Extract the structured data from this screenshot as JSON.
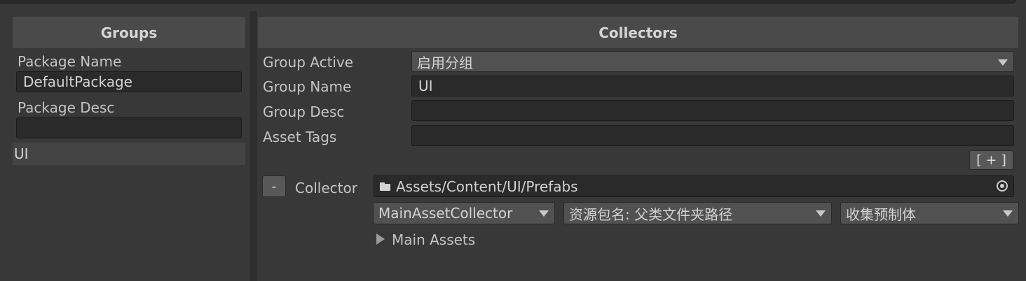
{
  "groups_panel": {
    "header": "Groups",
    "package_name_label": "Package Name",
    "package_name_value": "DefaultPackage",
    "package_desc_label": "Package Desc",
    "package_desc_value": "",
    "items": [
      "UI"
    ]
  },
  "collectors_panel": {
    "header": "Collectors",
    "group_active_label": "Group Active",
    "group_active_value": "启用分组",
    "group_name_label": "Group Name",
    "group_name_value": "UI",
    "group_desc_label": "Group Desc",
    "group_desc_value": "",
    "asset_tags_label": "Asset Tags",
    "asset_tags_value": "",
    "add_button_label": "[ + ]",
    "collector": {
      "remove_button_label": "-",
      "label": "Collector",
      "path": "Assets/Content/UI/Prefabs",
      "collector_type": "MainAssetCollector",
      "address_rule": "资源包名: 父类文件夹路径",
      "filter_rule": "收集预制体",
      "main_assets_label": "Main Assets"
    }
  },
  "icons": [
    "folder-icon",
    "object-picker-icon",
    "dropdown-caret-icon",
    "foldout-arrow-icon"
  ]
}
